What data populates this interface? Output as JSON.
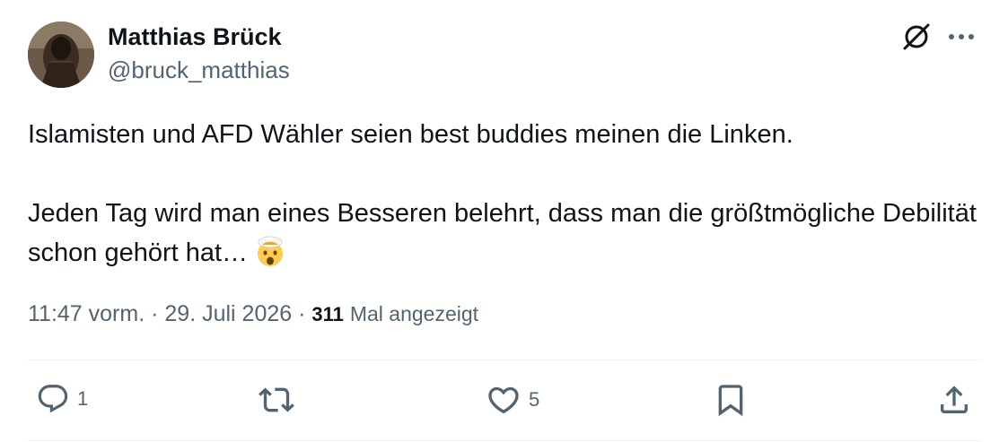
{
  "author": {
    "display_name": "Matthias Brück",
    "handle": "@bruck_matthias",
    "avatar_icon": "avatar-photo"
  },
  "header_icons": [
    "grok-icon",
    "more-icon"
  ],
  "tweet": {
    "line1": "Islamisten und AFD Wähler seien best buddies meinen die Linken.",
    "line2": "Jeden Tag wird man eines Besseren belehrt, dass man die größtmögliche Debilität schon gehört hat…",
    "emoji": "exploding-head-emoji"
  },
  "meta": {
    "time": "11:47 vorm.",
    "separator": "·",
    "date": "29. Juli 2026",
    "views_count": "311",
    "views_label": "Mal angezeigt"
  },
  "actions": {
    "reply_count": "1",
    "like_count": "5"
  },
  "colors": {
    "text": "#0f1419",
    "secondary": "#536471",
    "divider": "#eff3f4"
  }
}
